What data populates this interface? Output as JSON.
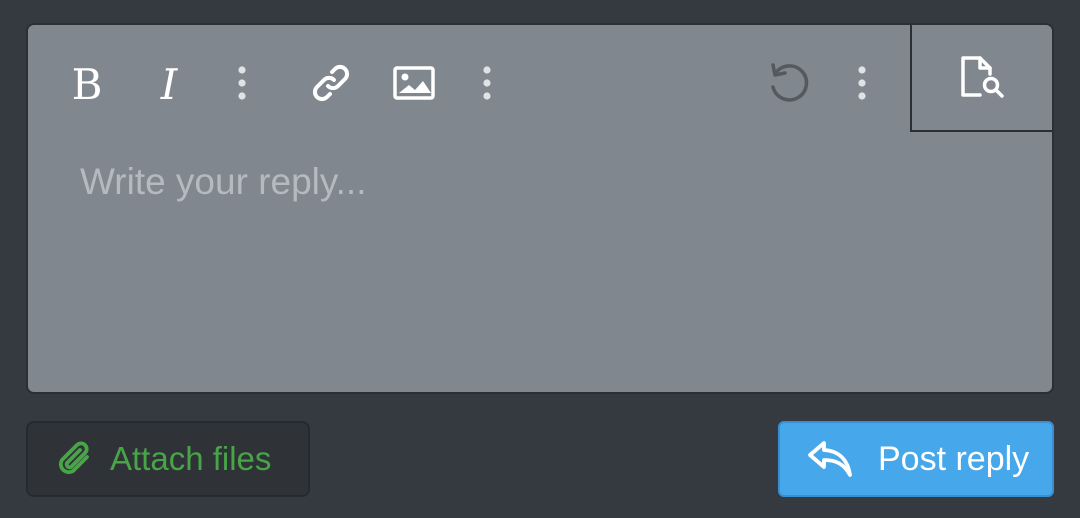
{
  "editor": {
    "placeholder": "Write your reply...",
    "value": "",
    "toolbar": {
      "bold_icon": "bold-icon",
      "italic_icon": "italic-icon",
      "more_text_icon": "more-vertical-icon",
      "link_icon": "link-icon",
      "image_icon": "image-icon",
      "more_insert_icon": "more-vertical-icon",
      "undo_icon": "undo-icon",
      "more_options_icon": "more-vertical-icon",
      "preview_icon": "preview-icon"
    }
  },
  "actions": {
    "attach_label": "Attach files",
    "attach_icon": "paperclip-icon",
    "post_label": "Post reply",
    "post_icon": "reply-icon"
  },
  "colors": {
    "background": "#353940",
    "editor_bg": "#80878f",
    "attach_text": "#47a447",
    "post_bg": "#47a7eb"
  }
}
